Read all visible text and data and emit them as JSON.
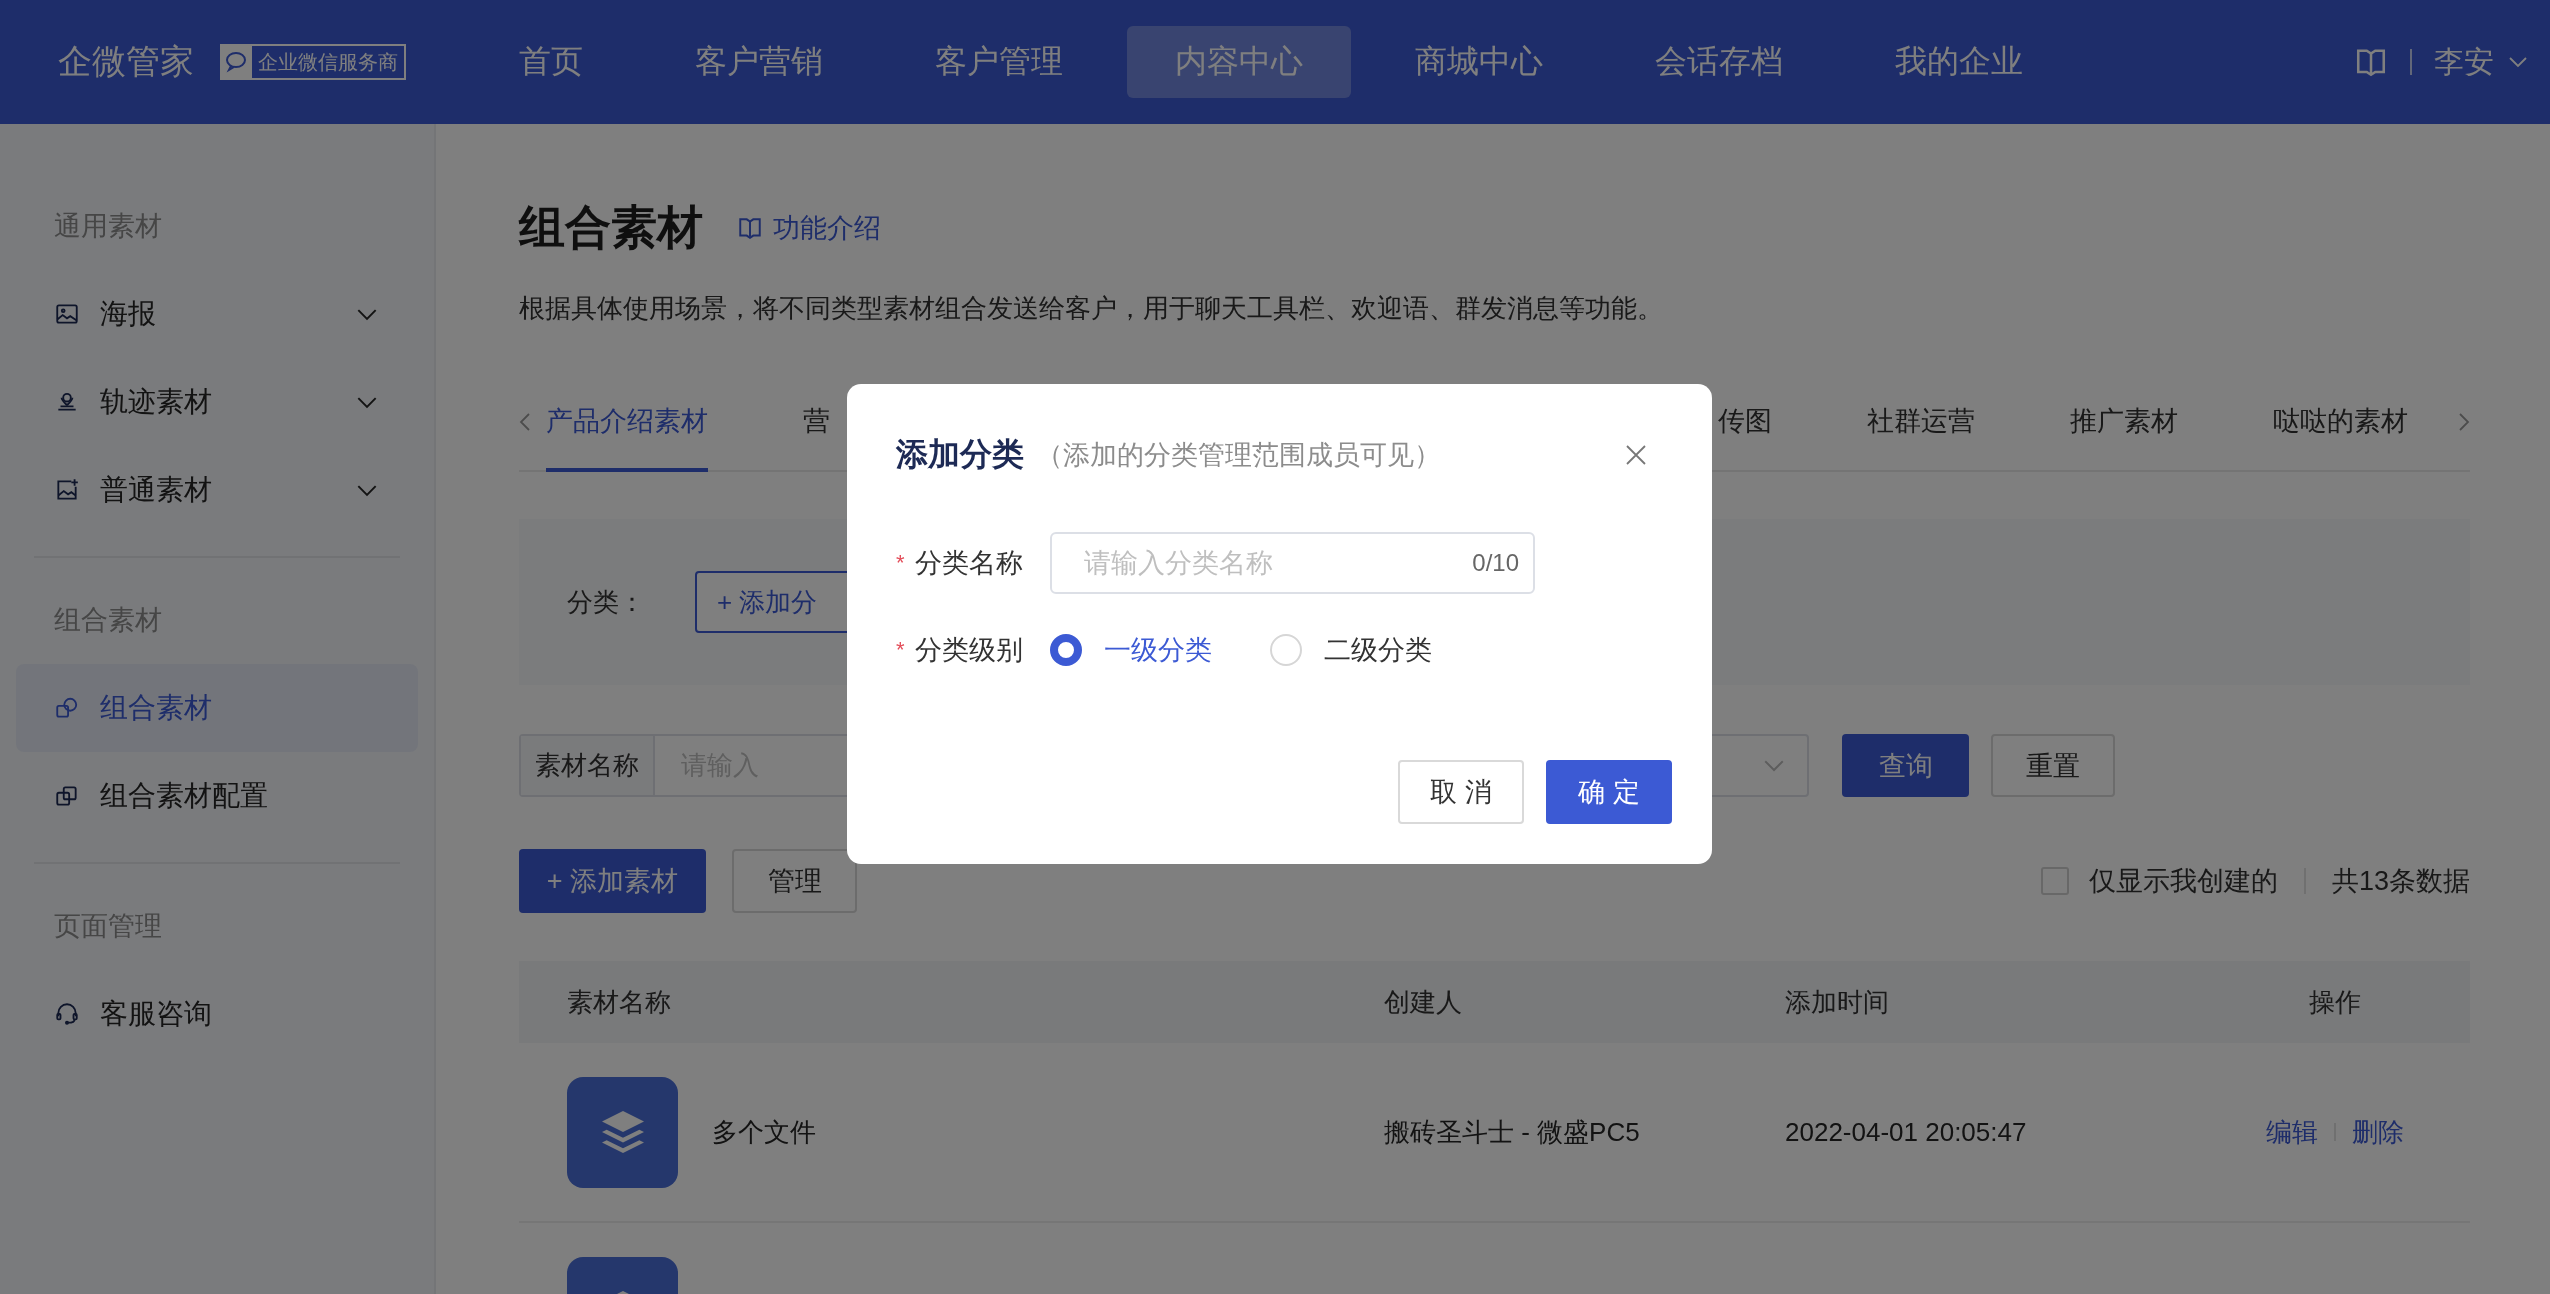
{
  "header": {
    "brand": "企微管家",
    "badge": "企业微信服务商",
    "nav": [
      {
        "label": "首页",
        "selected": false
      },
      {
        "label": "客户营销",
        "selected": false
      },
      {
        "label": "客户管理",
        "selected": false
      },
      {
        "label": "内容中心",
        "selected": true
      },
      {
        "label": "商城中心",
        "selected": false
      },
      {
        "label": "会话存档",
        "selected": false
      },
      {
        "label": "我的企业",
        "selected": false
      }
    ],
    "user": "李安"
  },
  "sidebar": [
    {
      "title": "通用素材",
      "items": [
        {
          "label": "海报",
          "expandable": true,
          "selected": false
        },
        {
          "label": "轨迹素材",
          "expandable": true,
          "selected": false
        },
        {
          "label": "普通素材",
          "expandable": true,
          "selected": false
        }
      ]
    },
    {
      "title": "组合素材",
      "items": [
        {
          "label": "组合素材",
          "expandable": false,
          "selected": true
        },
        {
          "label": "组合素材配置",
          "expandable": false,
          "selected": false
        }
      ]
    },
    {
      "title": "页面管理",
      "items": [
        {
          "label": "客服咨询",
          "expandable": false,
          "selected": false
        }
      ]
    }
  ],
  "page": {
    "title": "组合素材",
    "help_link": "功能介绍",
    "description": "根据具体使用场景，将不同类型素材组合发送给客户，用于聊天工具栏、欢迎语、群发消息等功能。",
    "tabs": [
      {
        "label": "产品介绍素材",
        "selected": true
      },
      {
        "label": "营",
        "selected": false
      },
      {
        "label": "传图",
        "selected": false
      },
      {
        "label": "社群运营",
        "selected": false
      },
      {
        "label": "推广素材",
        "selected": false
      },
      {
        "label": "哒哒的素材",
        "selected": false
      }
    ],
    "filter": {
      "label": "分类：",
      "add_button": "+ 添加分"
    },
    "search": {
      "label": "素材名称",
      "placeholder": "请输入",
      "query_button": "查询",
      "reset_button": "重置"
    },
    "actions": {
      "add_button": "+ 添加素材",
      "manage_button": "管理",
      "only_mine": {
        "label": "仅显示我创建的",
        "checked": false
      },
      "total": "共13条数据"
    },
    "table": {
      "columns": [
        "素材名称",
        "创建人",
        "添加时间",
        "操作"
      ],
      "rows": [
        {
          "cut_off": false,
          "name": "多个文件",
          "creator": "搬砖圣斗士 - 微盛PC5",
          "time": "2022-04-01 20:05:47",
          "actions": [
            "编辑",
            "删除"
          ]
        },
        {
          "cut_off": true
        }
      ]
    }
  },
  "dialog": {
    "title": "添加分类",
    "subtitle": "（添加的分类管理范围成员可见）",
    "fields": [
      {
        "kind": "text",
        "label": "分类名称",
        "required_mark": "*",
        "placeholder": "请输入分类名称",
        "counter": "0/10"
      },
      {
        "kind": "radio",
        "label": "分类级别",
        "required_mark": "*",
        "options": [
          {
            "label": "一级分类",
            "selected": true
          },
          {
            "label": "二级分类",
            "selected": false
          }
        ]
      }
    ],
    "buttons": [
      {
        "label": "取 消",
        "kind": "secondary"
      },
      {
        "label": "确 定",
        "kind": "primary"
      }
    ]
  }
}
